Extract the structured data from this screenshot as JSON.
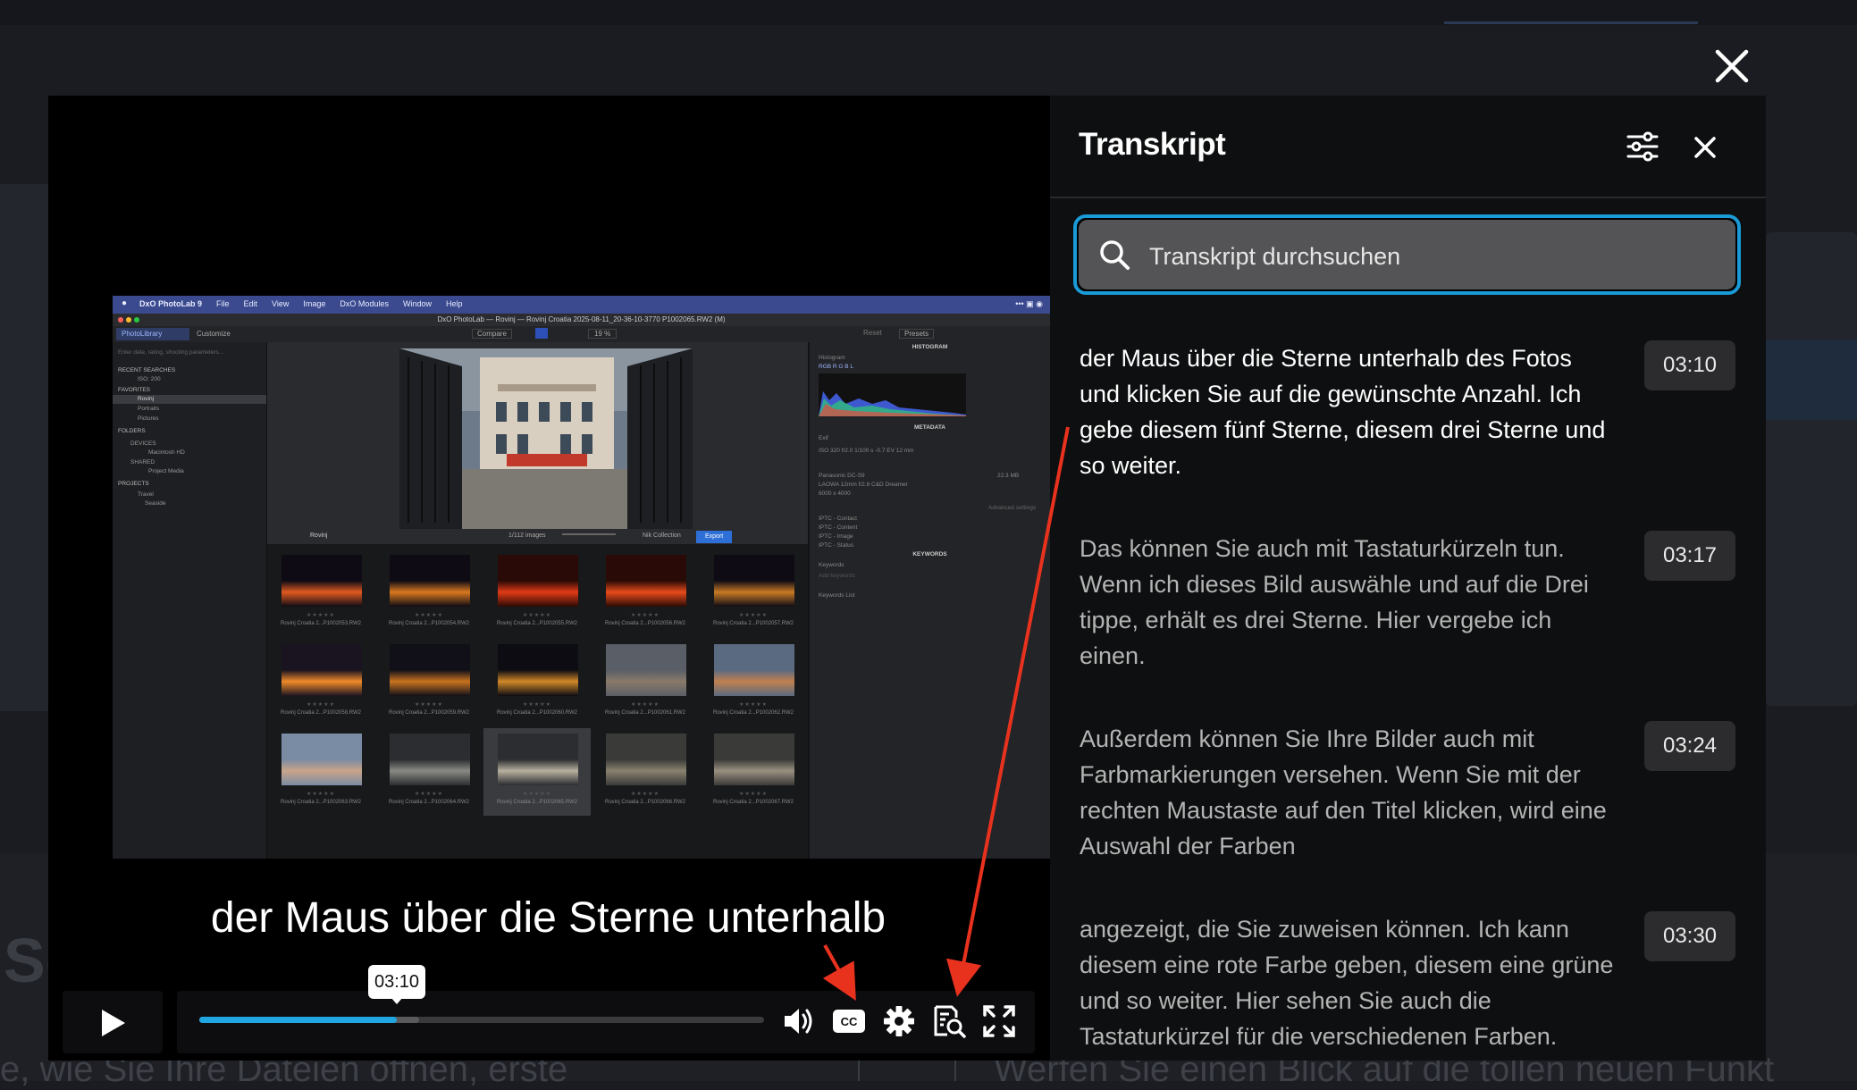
{
  "background": {
    "heading": "Sc",
    "text_left": "e, wie Sie Ihre Dateien öffnen, erste",
    "text_right": "Werfen Sie einen Blick auf die tollen neuen Funkt"
  },
  "app_window": {
    "app_name": "DxO PhotoLab 9",
    "menus": [
      "File",
      "Edit",
      "View",
      "Image",
      "DxO Modules",
      "Window",
      "Help"
    ],
    "document_title": "DxO PhotoLab — Rovinj — Rovinj Croatia 2025-08-11_20-36-10-3770 P1002065.RW2 (M)",
    "tabs": [
      "PhotoLibrary",
      "Customize"
    ],
    "toolbar": {
      "compare": "Compare",
      "zoom": "19 %",
      "reset": "Reset",
      "presets": "Presets"
    },
    "sidebar": {
      "search_placeholder": "Enter date, rating, shooting parameters...",
      "recent_searches": "RECENT SEARCHES",
      "recent_item": "ISO: 200",
      "favorites": "FAVORITES",
      "favorite_items": [
        "Rovinj",
        "Portraits",
        "Pictures"
      ],
      "folders": "FOLDERS",
      "devices": "DEVICES",
      "device_item": "Macintosh HD",
      "shared": "SHARED",
      "shared_item": "Project Media",
      "projects": "PROJECTS",
      "project_items": [
        "Travel",
        "Seaside"
      ]
    },
    "filmstrip_bar": {
      "folder": "Rovinj",
      "count": "1/112 images",
      "nik": "Nik Collection",
      "export": "Export"
    },
    "thumbnails": [
      "Rovinj Croatia 2...P1002053.RW2",
      "Rovinj Croatia 2...P1002054.RW2",
      "Rovinj Croatia 2...P1002055.RW2",
      "Rovinj Croatia 2...P1002056.RW2",
      "Rovinj Croatia 2...P1002057.RW2",
      "Rovinj Croatia 2...P1002058.RW2",
      "Rovinj Croatia 2...P1002059.RW2",
      "Rovinj Croatia 2...P1002060.RW2",
      "Rovinj Croatia 2...P1002061.RW2",
      "Rovinj Croatia 2...P1002062.RW2",
      "Rovinj Croatia 2...P1002063.RW2",
      "Rovinj Croatia 2...P1002064.RW2",
      "Rovinj Croatia 2...P1002065.RW2",
      "Rovinj Croatia 2...P1002066.RW2",
      "Rovinj Croatia 2...P1002067.RW2"
    ],
    "right_panel": {
      "histogram": "HISTOGRAM",
      "histogram_label": "Histogram",
      "channels": "RGB  R  G  B  L",
      "metadata": "METADATA",
      "exif": "Exif",
      "exif_values": "ISO 320   f/2.0   1/100 s   -0.7 EV   12 mm",
      "camera": "Panasonic DC-S9",
      "filesize": "22.3 MB",
      "lens": "LAOWA 12mm f/2.8 C&D Dreamer",
      "dims": "6000 x 4000",
      "advanced": "Advanced settings",
      "iptc": [
        "IPTC - Contact",
        "IPTC - Content",
        "IPTC - Image",
        "IPTC - Status"
      ],
      "keywords_hdr": "KEYWORDS",
      "keywords": "Keywords",
      "add_keywords": "Add keywords",
      "keywords_list": "Keywords List"
    }
  },
  "player": {
    "caption": "der Maus über die Sterne unterhalb",
    "current_time": "03:10",
    "progress_percent": 35,
    "buffered_percent": 39
  },
  "transcript": {
    "title": "Transkript",
    "search_placeholder": "Transkript durchsuchen",
    "active_color": "#ffffff",
    "inactive_color": "#b4b4b4",
    "accent_color": "#1a9ad6",
    "arrow_color": "#e8321e",
    "entries": [
      {
        "text": "der Maus über die Sterne unterhalb des Fotos und klicken Sie auf die gewünschte Anzahl. Ich gebe diesem fünf Sterne, diesem drei Sterne und so weiter.",
        "time": "03:10",
        "active": true
      },
      {
        "text": "Das können Sie auch mit Tastaturkürzeln tun. Wenn ich dieses Bild auswähle und auf die Drei tippe, erhält es drei Sterne. Hier vergebe ich einen.",
        "time": "03:17",
        "active": false
      },
      {
        "text": "Außerdem können Sie Ihre Bilder auch mit Farbmarkierungen versehen. Wenn Sie mit der rechten Maustaste auf den Titel klicken, wird eine Auswahl der Farben",
        "time": "03:24",
        "active": false
      },
      {
        "text": "angezeigt, die Sie zuweisen können. Ich kann diesem eine rote Farbe geben, diesem eine grüne und so weiter. Hier sehen Sie auch die Tastaturkürzel für die verschiedenen Farben.",
        "time": "03:30",
        "active": false
      }
    ]
  }
}
